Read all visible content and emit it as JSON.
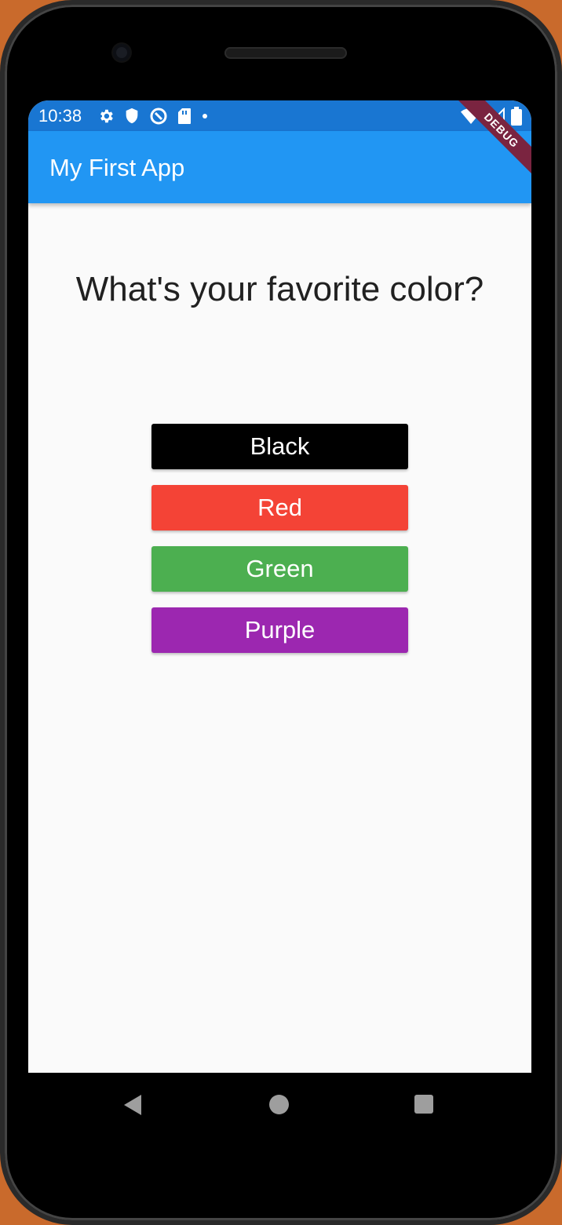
{
  "status_bar": {
    "time": "10:38",
    "left_icons": [
      "settings-icon",
      "shield-icon",
      "vpn-icon",
      "sd-card-icon",
      "dot-icon"
    ],
    "right_icons": [
      "wifi-icon",
      "signal-icon",
      "battery-icon"
    ]
  },
  "app_bar": {
    "title": "My First App",
    "debug_banner": "DEBUG"
  },
  "quiz": {
    "question": "What's your favorite color?",
    "answers": [
      {
        "label": "Black",
        "color": "#000000"
      },
      {
        "label": "Red",
        "color": "#f44336"
      },
      {
        "label": "Green",
        "color": "#4caf50"
      },
      {
        "label": "Purple",
        "color": "#9c27b0"
      }
    ]
  },
  "nav_bar": {
    "buttons": [
      "back-icon",
      "home-icon",
      "recents-icon"
    ]
  },
  "colors": {
    "status_bar": "#1976d2",
    "app_bar": "#2196f3",
    "background": "#fafafa"
  }
}
